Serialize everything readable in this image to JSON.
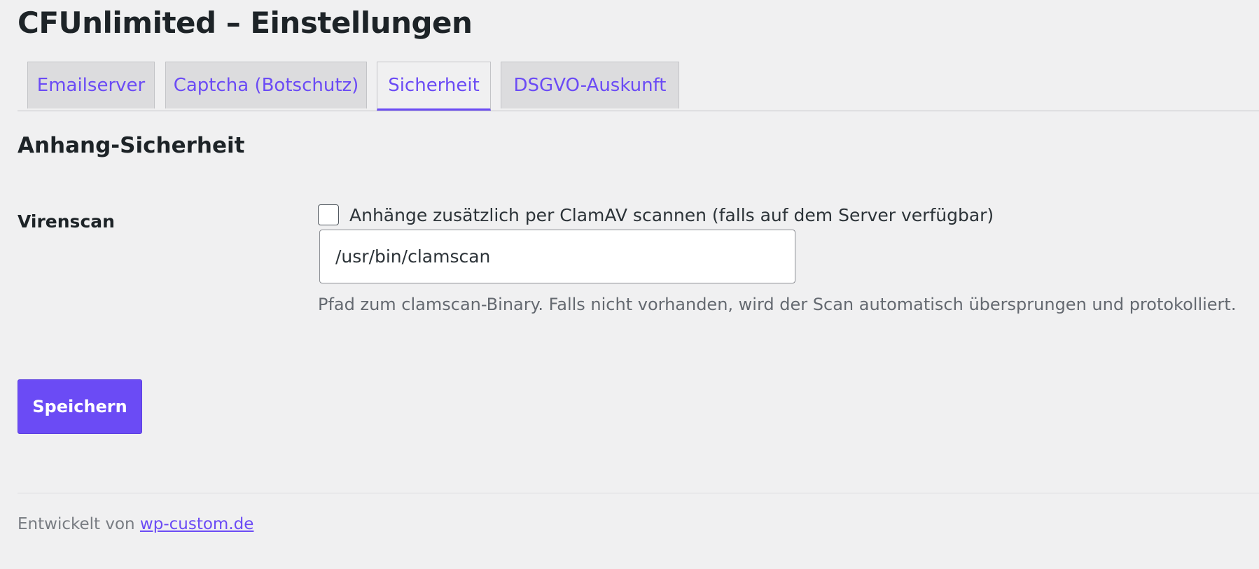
{
  "page": {
    "title": "CFUnlimited – Einstellungen"
  },
  "tabs": [
    {
      "label": "Emailserver",
      "active": false
    },
    {
      "label": "Captcha (Botschutz)",
      "active": false
    },
    {
      "label": "Sicherheit",
      "active": true
    },
    {
      "label": "DSGVO-Auskunft",
      "active": false
    }
  ],
  "section": {
    "title": "Anhang-Sicherheit"
  },
  "virus_scan": {
    "label": "Virenscan",
    "checkbox_label": "Anhänge zusätzlich per ClamAV scannen (falls auf dem Server verfügbar)",
    "checked": false,
    "path_value": "/usr/bin/clamscan",
    "description": "Pfad zum clamscan-Binary. Falls nicht vorhanden, wird der Scan automatisch übersprungen und protokolliert."
  },
  "actions": {
    "save_label": "Speichern"
  },
  "footer": {
    "prefix": "Entwickelt von ",
    "link_text": "wp-custom.de"
  },
  "colors": {
    "accent": "#6b4bf5",
    "background": "#f0f0f1",
    "tab_inactive_bg": "#dcdcde"
  }
}
